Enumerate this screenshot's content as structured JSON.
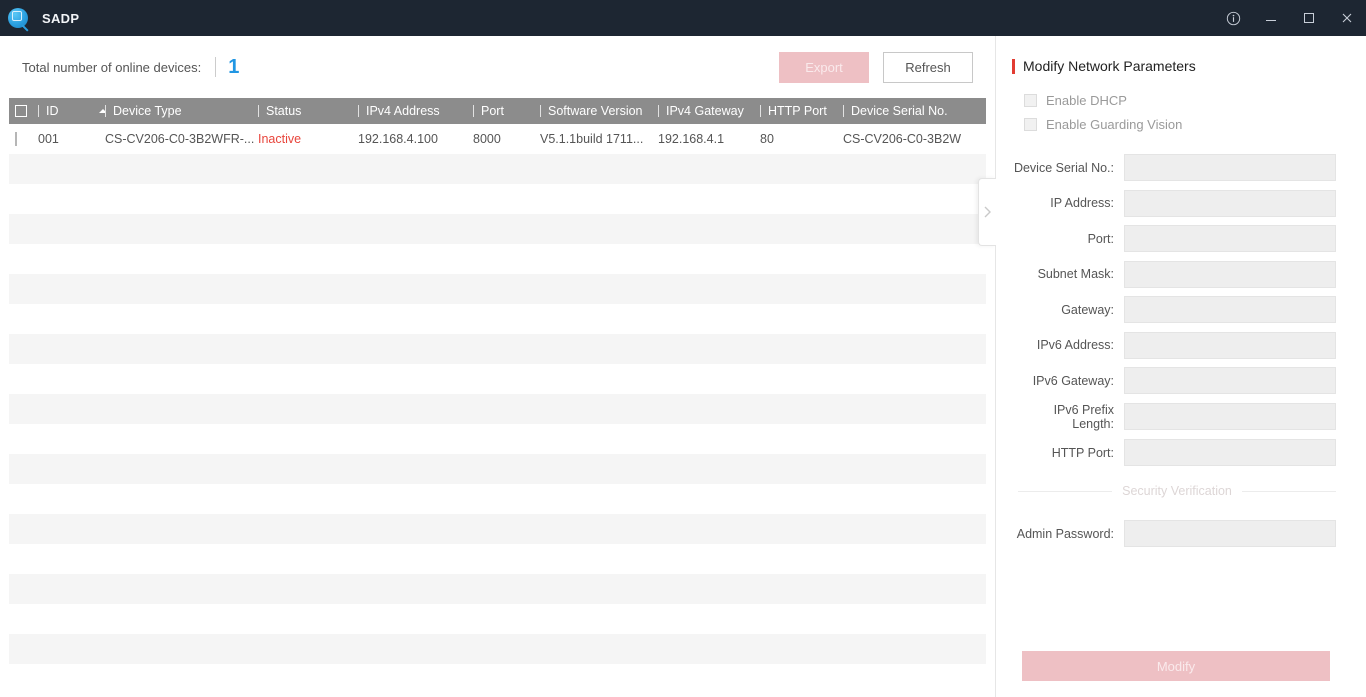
{
  "titlebar": {
    "app_name": "SADP",
    "logo_icon": "sadp-magnifier-logo",
    "info_icon": "info-circle-icon",
    "minimize_icon": "minimize-icon",
    "maximize_icon": "maximize-icon",
    "close_icon": "close-icon",
    "bg_color": "#1d2632"
  },
  "toolbar": {
    "online_label": "Total number of online devices:",
    "online_count": "1",
    "count_color": "#2196e3",
    "export_label": "Export",
    "refresh_label": "Refresh",
    "export_disabled_color": "#eec0c4"
  },
  "table": {
    "header_bg": "#8c8c8c",
    "sort_column": "ID",
    "sort_direction": "ascending",
    "columns": [
      {
        "key": "check",
        "label": ""
      },
      {
        "key": "id",
        "label": "ID"
      },
      {
        "key": "type",
        "label": "Device Type"
      },
      {
        "key": "status",
        "label": "Status"
      },
      {
        "key": "ip",
        "label": "IPv4 Address"
      },
      {
        "key": "port",
        "label": "Port"
      },
      {
        "key": "sw",
        "label": "Software Version"
      },
      {
        "key": "gw",
        "label": "IPv4 Gateway"
      },
      {
        "key": "http",
        "label": "HTTP Port"
      },
      {
        "key": "serial",
        "label": "Device Serial No."
      }
    ],
    "rows": [
      {
        "id": "001",
        "type": "CS-CV206-C0-3B2WFR-...",
        "status": "Inactive",
        "status_color": "#e8453c",
        "ip": "192.168.4.100",
        "port": "8000",
        "sw": "V5.1.1build 1711...",
        "gw": "192.168.4.1",
        "http": "80",
        "serial": "CS-CV206-C0-3B2W"
      }
    ],
    "empty_row_count": 17,
    "collapse_icon": "chevron-right-icon"
  },
  "panel": {
    "title": "Modify Network Parameters",
    "accent_color": "#e23c32",
    "checkboxes": [
      {
        "label": "Enable DHCP",
        "checked": false
      },
      {
        "label": "Enable Guarding Vision",
        "checked": false
      }
    ],
    "fields": [
      {
        "label": "Device Serial No.:",
        "value": "",
        "placeholder": ""
      },
      {
        "label": "IP Address:",
        "value": "",
        "placeholder": ""
      },
      {
        "label": "Port:",
        "value": "",
        "placeholder": ""
      },
      {
        "label": "Subnet Mask:",
        "value": "",
        "placeholder": ""
      },
      {
        "label": "Gateway:",
        "value": "",
        "placeholder": ""
      },
      {
        "label": "IPv6 Address:",
        "value": "",
        "placeholder": ""
      },
      {
        "label": "IPv6 Gateway:",
        "value": "",
        "placeholder": ""
      },
      {
        "label": "IPv6 Prefix Length:",
        "value": "",
        "placeholder": ""
      },
      {
        "label": "HTTP Port:",
        "value": "",
        "placeholder": ""
      }
    ],
    "divider_label": "Security Verification",
    "password_field": {
      "label": "Admin Password:",
      "value": "",
      "placeholder": ""
    },
    "modify_label": "Modify",
    "modify_disabled_color": "#eec0c4"
  }
}
